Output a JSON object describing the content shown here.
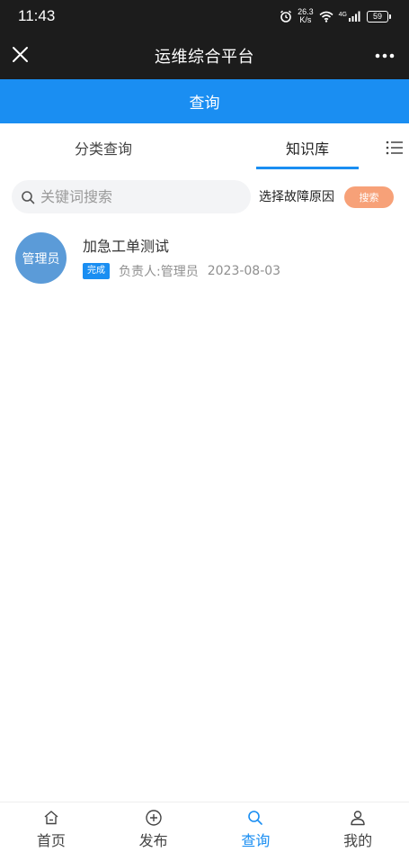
{
  "status_bar": {
    "time": "11:43",
    "net_speed_value": "26.3",
    "net_speed_unit": "K/s",
    "network": "4G",
    "battery": "59",
    "icons": [
      "alarm-icon",
      "wifi-icon",
      "signal-icon",
      "battery-icon"
    ]
  },
  "titlebar": {
    "title": "运维综合平台",
    "close_icon": "close-icon",
    "more_icon": "more-icon"
  },
  "page": {
    "header": "查询"
  },
  "tabs": {
    "items": [
      {
        "label": "分类查询",
        "active": false
      },
      {
        "label": "知识库",
        "active": true
      }
    ],
    "menu_icon": "list-icon"
  },
  "search": {
    "placeholder": "关键词搜索",
    "value": "",
    "reason_label": "选择故障原因",
    "button_label": "搜索"
  },
  "list": {
    "items": [
      {
        "avatar_text": "管理员",
        "title": "加急工单测试",
        "status": "完成",
        "owner": "负责人:管理员",
        "date": "2023-08-03"
      }
    ]
  },
  "bottom_nav": {
    "items": [
      {
        "label": "首页",
        "icon": "home-icon",
        "active": false
      },
      {
        "label": "发布",
        "icon": "plus-circle-icon",
        "active": false
      },
      {
        "label": "查询",
        "icon": "search-icon",
        "active": true
      },
      {
        "label": "我的",
        "icon": "user-icon",
        "active": false
      }
    ]
  },
  "colors": {
    "primary": "#1a8ef2",
    "dark_bar": "#1c1c1c",
    "search_button": "#f7a178",
    "avatar": "#5b9bd8"
  }
}
